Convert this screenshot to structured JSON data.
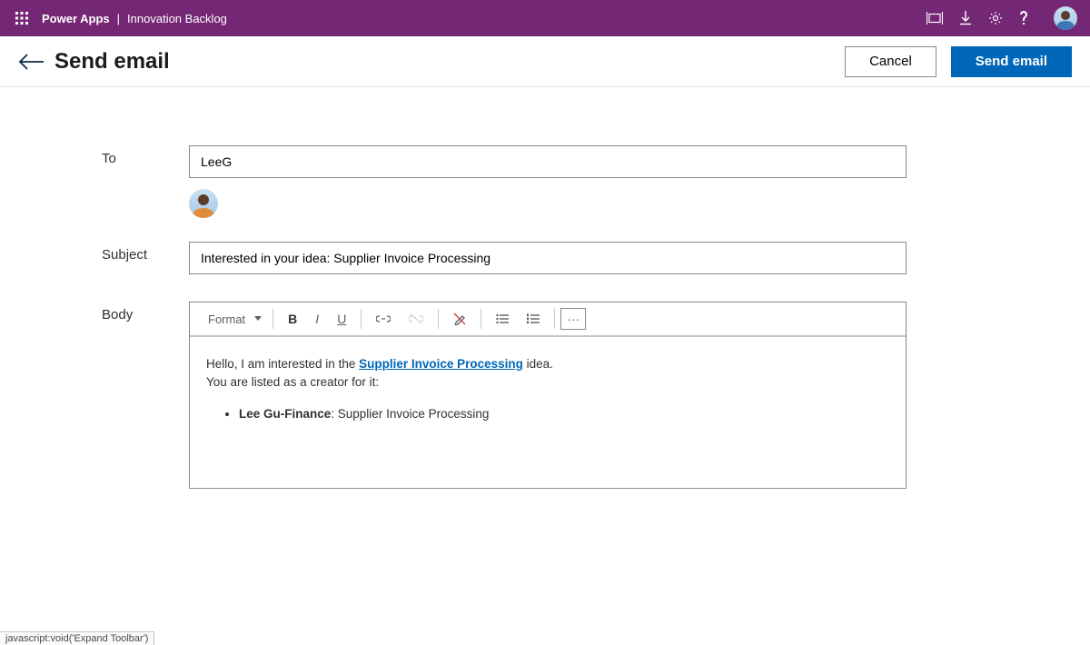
{
  "appbar": {
    "brand": "Power Apps",
    "separator": "|",
    "app_name": "Innovation Backlog"
  },
  "page": {
    "title": "Send email",
    "cancel_label": "Cancel",
    "send_label": "Send email"
  },
  "form": {
    "to_label": "To",
    "to_value": "LeeG",
    "subject_label": "Subject",
    "subject_value": "Interested in your idea: Supplier Invoice Processing",
    "body_label": "Body"
  },
  "rte": {
    "format_label": "Format",
    "bold_glyph": "B",
    "italic_glyph": "I",
    "underline_glyph": "U",
    "more_glyph": "···"
  },
  "body_content": {
    "line1_pre": "Hello, I am interested in the ",
    "line1_link": "Supplier Invoice Processing",
    "line1_post": " idea.",
    "line2": "You are listed as a creator for it:",
    "bullet_strong": "Lee Gu-Finance",
    "bullet_rest": ": Supplier Invoice Processing"
  },
  "statusbar": {
    "text": "javascript:void('Expand Toolbar')"
  }
}
